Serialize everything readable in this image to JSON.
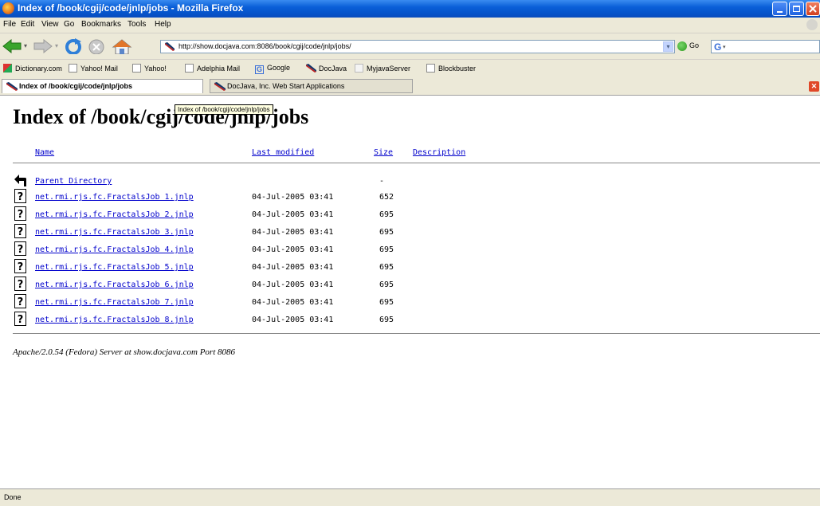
{
  "window": {
    "title": "Index of /book/cgij/code/jnlp/jobs - Mozilla Firefox"
  },
  "menu": [
    "File",
    "Edit",
    "View",
    "Go",
    "Bookmarks",
    "Tools",
    "Help"
  ],
  "toolbar": {
    "url": "http://show.docjava.com:8086/book/cgij/code/jnlp/jobs/",
    "go_label": "Go",
    "search_value": ""
  },
  "bookmarks": [
    "Dictionary.com",
    "Yahoo! Mail",
    "Yahoo!",
    "Adelphia Mail",
    "Google",
    "DocJava",
    "MyjavaServer",
    "Blockbuster"
  ],
  "tabs": [
    {
      "label": "Index of /book/cgij/code/jnlp/jobs",
      "active": true
    },
    {
      "label": "DocJava, Inc. Web Start Applications",
      "active": false
    }
  ],
  "page": {
    "heading": "Index of /book/cgij/code/jnlp/jobs",
    "tooltip": "Index of /book/cgij/code/jnlp/jobs",
    "columns": {
      "name": "Name",
      "modified": "Last modified",
      "size": "Size",
      "description": "Description"
    },
    "parent": {
      "name": "Parent Directory",
      "size": "-"
    },
    "files": [
      {
        "name": "net.rmi.rjs.fc.FractalsJob 1.jnlp",
        "modified": "04-Jul-2005 03:41",
        "size": "652"
      },
      {
        "name": "net.rmi.rjs.fc.FractalsJob 2.jnlp",
        "modified": "04-Jul-2005 03:41",
        "size": "695"
      },
      {
        "name": "net.rmi.rjs.fc.FractalsJob 3.jnlp",
        "modified": "04-Jul-2005 03:41",
        "size": "695"
      },
      {
        "name": "net.rmi.rjs.fc.FractalsJob 4.jnlp",
        "modified": "04-Jul-2005 03:41",
        "size": "695"
      },
      {
        "name": "net.rmi.rjs.fc.FractalsJob 5.jnlp",
        "modified": "04-Jul-2005 03:41",
        "size": "695"
      },
      {
        "name": "net.rmi.rjs.fc.FractalsJob 6.jnlp",
        "modified": "04-Jul-2005 03:41",
        "size": "695"
      },
      {
        "name": "net.rmi.rjs.fc.FractalsJob 7.jnlp",
        "modified": "04-Jul-2005 03:41",
        "size": "695"
      },
      {
        "name": "net.rmi.rjs.fc.FractalsJob 8.jnlp",
        "modified": "04-Jul-2005 03:41",
        "size": "695"
      }
    ],
    "address": "Apache/2.0.54 (Fedora) Server at show.docjava.com Port 8086"
  },
  "status": {
    "text": "Done"
  }
}
